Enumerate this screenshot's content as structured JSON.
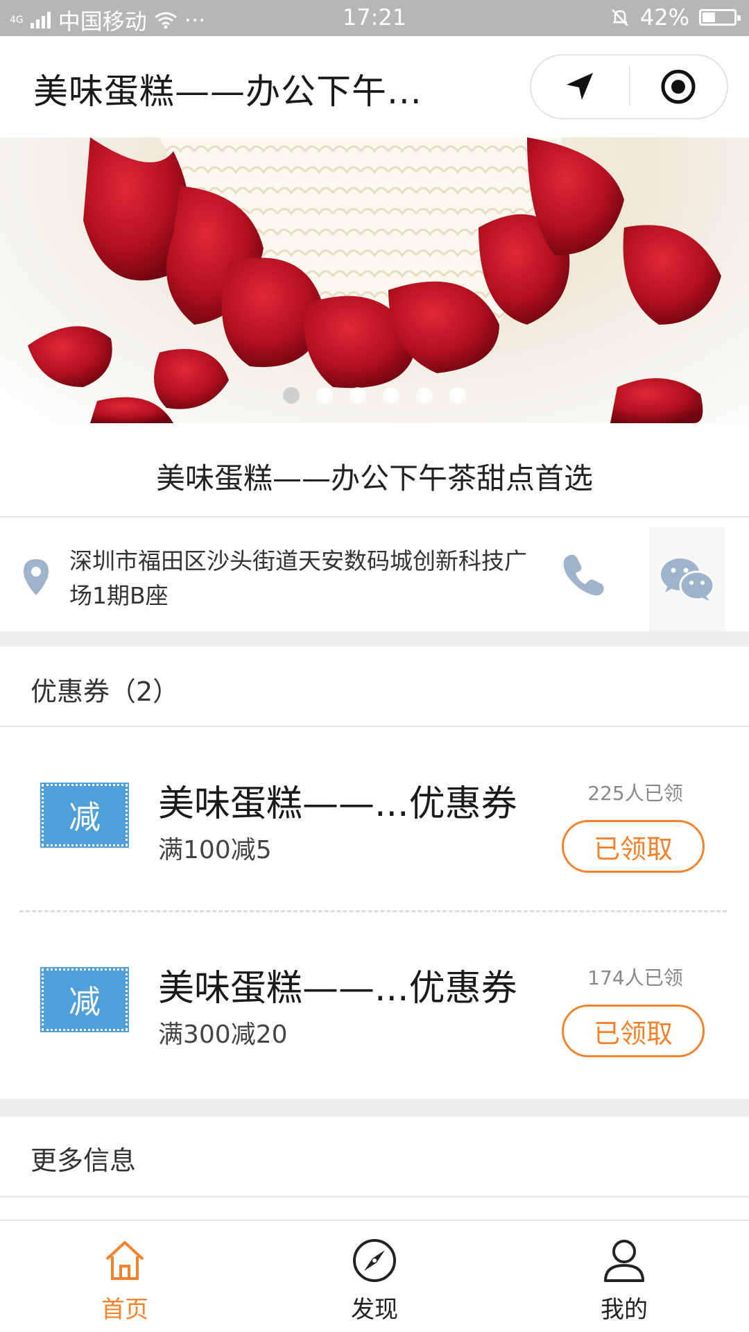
{
  "status_bar": {
    "signal": "4G",
    "carrier": "中国移动",
    "extra": "···",
    "time": "17:21",
    "battery": "42%",
    "battery_level": 0.42
  },
  "nav": {
    "title": "美味蛋糕——办公下午..."
  },
  "banner": {
    "slide_count": 6,
    "active_index": 0
  },
  "shop": {
    "title": "美味蛋糕——办公下午茶甜点首选",
    "address": "深圳市福田区沙头街道天安数码城创新科技广场1期B座"
  },
  "coupons": {
    "header": "优惠券（2）",
    "items": [
      {
        "badge": "减",
        "title": "美味蛋糕——...优惠券",
        "rule": "满100减5",
        "claimed": "225人已领",
        "button": "已领取"
      },
      {
        "badge": "减",
        "title": "美味蛋糕——...优惠券",
        "rule": "满300减20",
        "claimed": "174人已领",
        "button": "已领取"
      }
    ]
  },
  "more_info": {
    "header": "更多信息"
  },
  "tabbar": {
    "items": [
      {
        "label": "首页",
        "icon": "home-icon",
        "active": true
      },
      {
        "label": "发现",
        "icon": "compass-icon",
        "active": false
      },
      {
        "label": "我的",
        "icon": "user-icon",
        "active": false
      }
    ]
  },
  "colors": {
    "accent": "#f5822a",
    "coupon_badge": "#4fa0d8",
    "status_bar": "#b6b6b6",
    "icon_gray": "#9fb4cc"
  }
}
